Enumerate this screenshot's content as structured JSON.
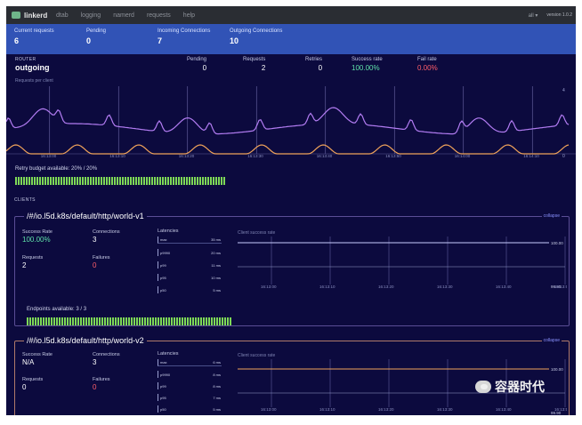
{
  "nav": {
    "brand": "linkerd",
    "items": [
      "dtab",
      "logging",
      "namerd",
      "requests",
      "help"
    ],
    "router_select": "all",
    "version": "version 1.0.2"
  },
  "summary": [
    {
      "label": "Current requests",
      "value": "6"
    },
    {
      "label": "Pending",
      "value": "0"
    },
    {
      "label": "Incoming Connections",
      "value": "7"
    },
    {
      "label": "Outgoing Connections",
      "value": "10"
    }
  ],
  "router": {
    "section_label": "ROUTER",
    "name": "outgoing",
    "stats": [
      {
        "label": "Pending",
        "value": "0"
      },
      {
        "label": "Requests",
        "value": "2"
      },
      {
        "label": "Retries",
        "value": "0"
      },
      {
        "label": "Success rate",
        "value": "100.00%"
      },
      {
        "label": "Fail rate",
        "value": "0.00%"
      }
    ],
    "chart_title": "Requests per client",
    "chart_ymax": "4",
    "chart_ymin": "0",
    "chart_ticks": [
      "16:13:00",
      "16:13:10",
      "16:13:20",
      "16:13:30",
      "16:13:40",
      "16:13:50",
      "16:14:00",
      "16:14:10"
    ]
  },
  "retry_budget": "Retry budget available: 20% / 20%",
  "clients_label": "CLIENTS",
  "clients": [
    {
      "name": "/#/io.l5d.k8s/default/http/world-v1",
      "collapse": "collapse",
      "success_label": "Success Rate",
      "success_value": "100.00%",
      "connections_label": "Connections",
      "connections_value": "3",
      "requests_label": "Requests",
      "requests_value": "2",
      "failures_label": "Failures",
      "failures_value": "0",
      "latencies_label": "Latencies",
      "latencies": [
        {
          "k": "max",
          "v": "35 ms"
        },
        {
          "k": "p9990",
          "v": "20 ms"
        },
        {
          "k": "p99",
          "v": "11 ms"
        },
        {
          "k": "p95",
          "v": "10 ms"
        },
        {
          "k": "p50",
          "v": "5 ms"
        }
      ],
      "chart_title": "Client success rate",
      "chart_top": "100.00",
      "chart_bottom": "99.90",
      "chart_ticks": [
        "16:13:00",
        "16:13:10",
        "16:13:20",
        "16:13:30",
        "16:13:40",
        "16:13:50"
      ],
      "endpoints": "Endpoints available: 3 / 3"
    },
    {
      "name": "/#/io.l5d.k8s/default/http/world-v2",
      "collapse": "collapse",
      "success_label": "Success Rate",
      "success_value": "N/A",
      "connections_label": "Connections",
      "connections_value": "3",
      "requests_label": "Requests",
      "requests_value": "0",
      "failures_label": "Failures",
      "failures_value": "0",
      "latencies_label": "Latencies",
      "latencies": [
        {
          "k": "max",
          "v": "6 ms"
        },
        {
          "k": "p9990",
          "v": "8 ms"
        },
        {
          "k": "p99",
          "v": "8 ms"
        },
        {
          "k": "p95",
          "v": "7 ms"
        },
        {
          "k": "p50",
          "v": "5 ms"
        }
      ],
      "chart_title": "Client success rate",
      "chart_top": "100.00",
      "chart_bottom": "99.90",
      "chart_ticks": [
        "16:13:00",
        "16:13:10",
        "16:13:20",
        "16:13:30",
        "16:13:40",
        "16:13:50"
      ]
    }
  ],
  "watermark": "容器时代",
  "colors": {
    "background": "#0c0a3e",
    "summary_bar": "#3153b6",
    "series_purple": "#b27cf2",
    "series_orange": "#f0a35a",
    "success_green": "#5fe0a8",
    "fail_red": "#ff5e6a",
    "budget_green": "#7ed957"
  }
}
